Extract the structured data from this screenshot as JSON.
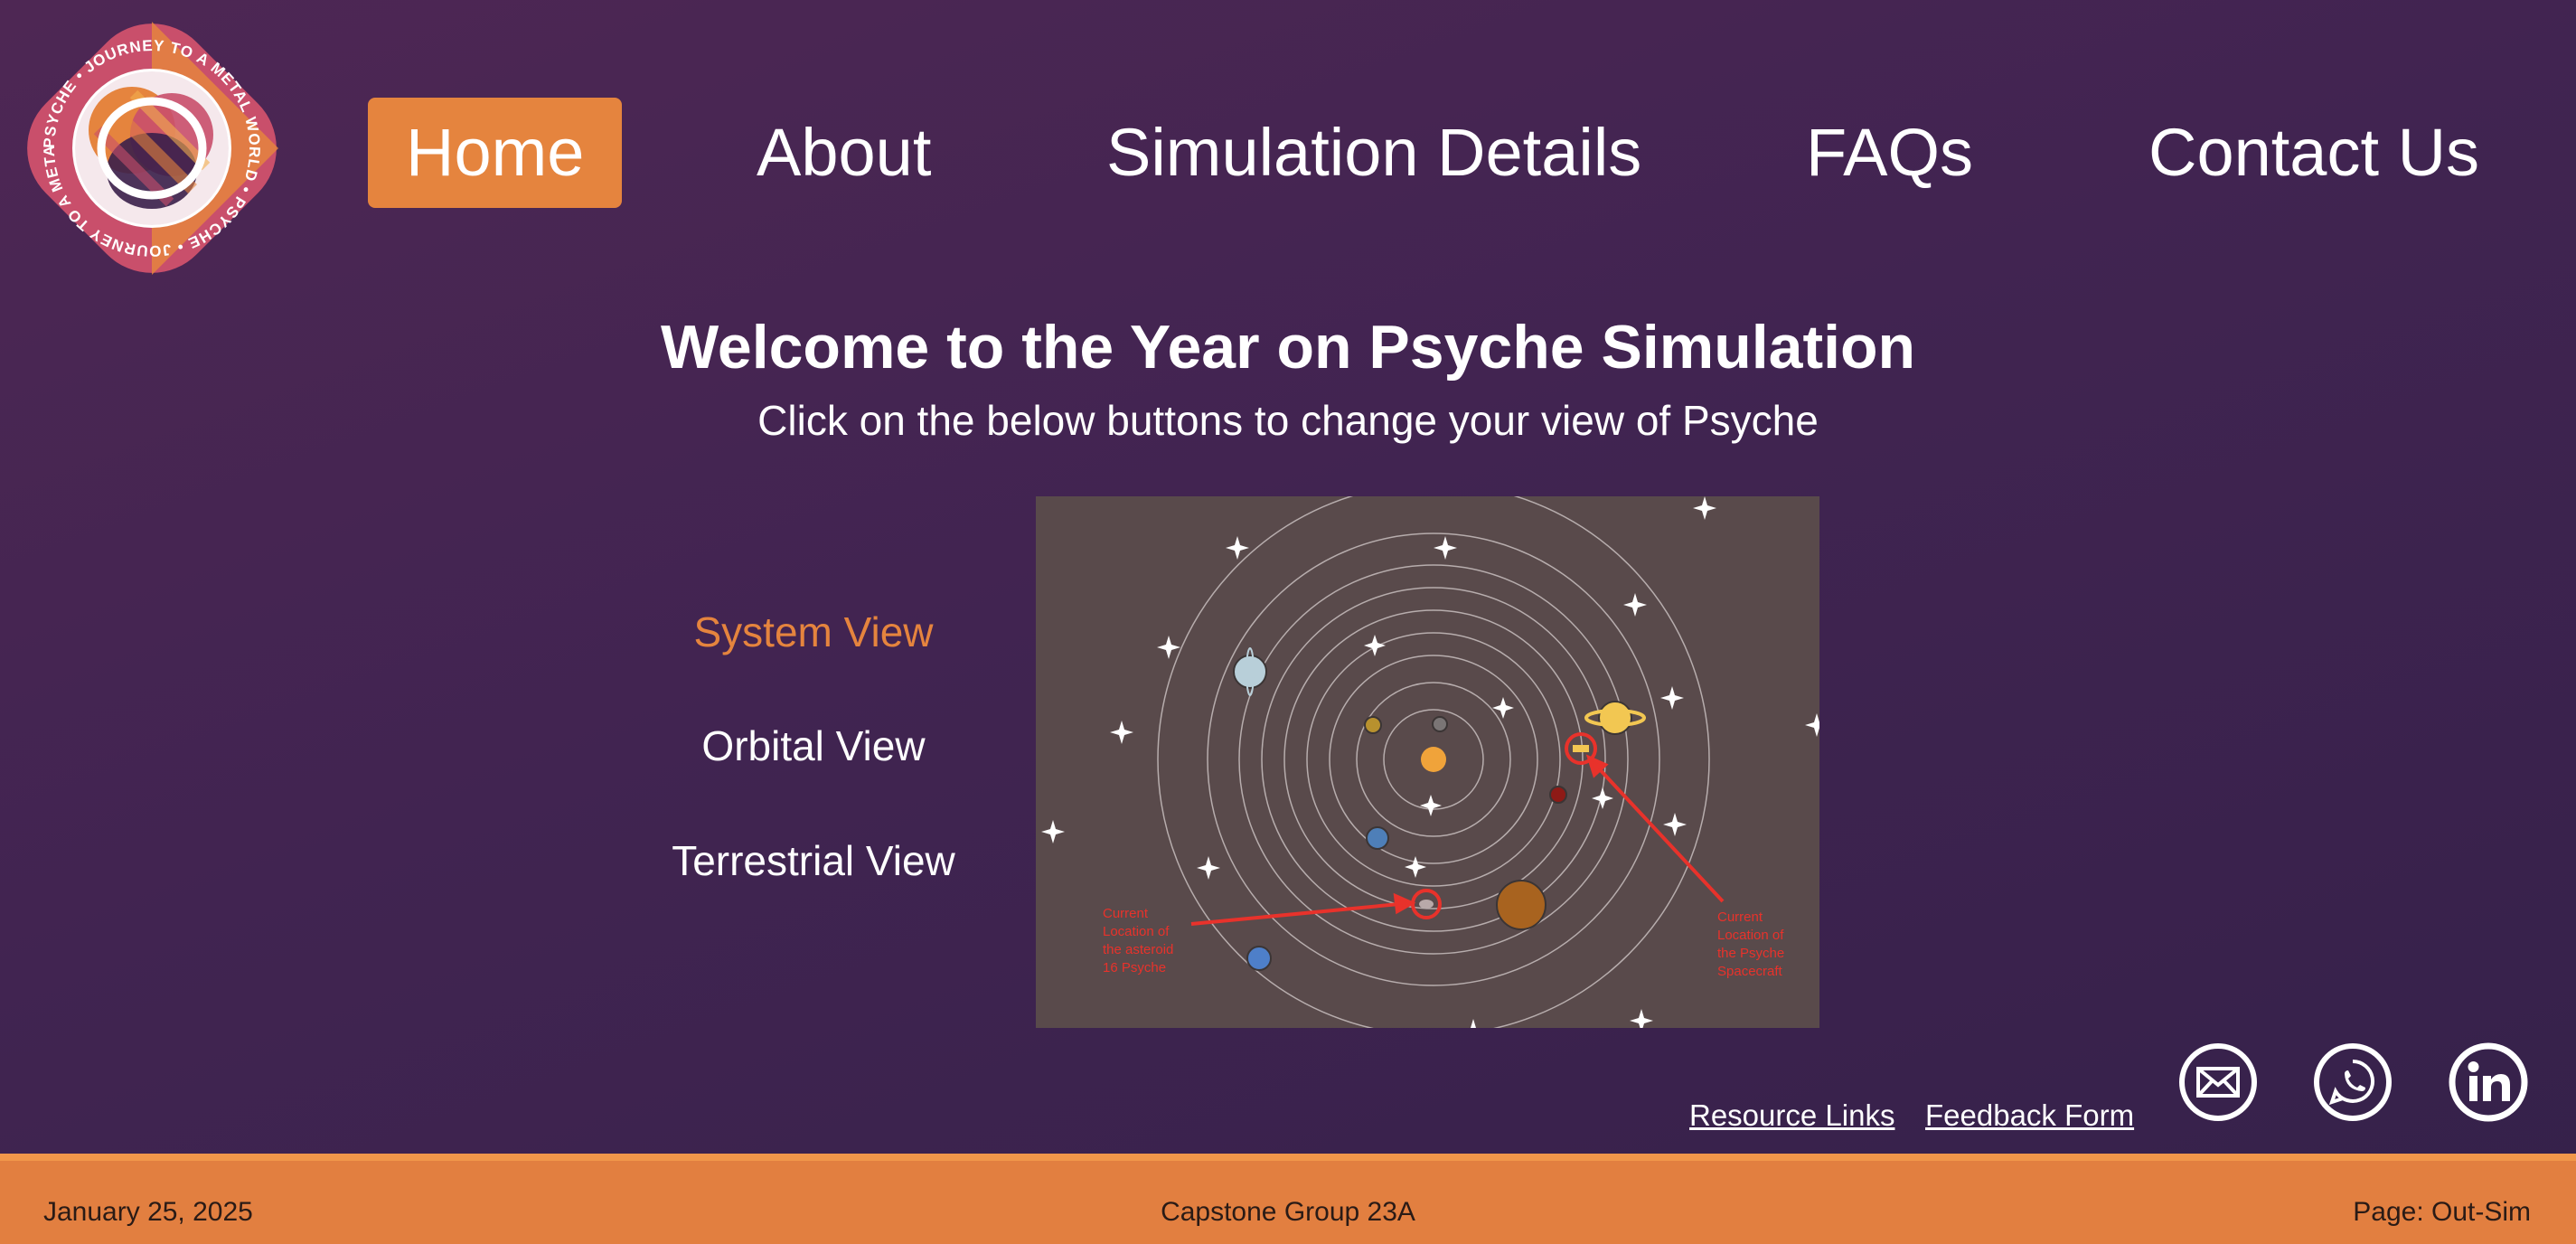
{
  "logo": {
    "text": "PSYCHE • JOURNEY TO A METAL WORLD • PSYCHE • JOURNEY TO A METAL WORLD •",
    "colors": {
      "orange": "#e5843e",
      "pink": "#c94f6b",
      "purple": "#3a1f4a"
    }
  },
  "nav": {
    "items": [
      {
        "label": "Home",
        "active": true
      },
      {
        "label": "About"
      },
      {
        "label": "Simulation Details"
      },
      {
        "label": "FAQs"
      },
      {
        "label": "Contact Us"
      }
    ]
  },
  "main": {
    "title": "Welcome to the Year on Psyche Simulation",
    "subtitle": "Click on the below buttons to change your view of Psyche"
  },
  "views": [
    {
      "label": "System View",
      "active": true
    },
    {
      "label": "Orbital View"
    },
    {
      "label": "Terrestrial View"
    }
  ],
  "simulation": {
    "asteroid_label": [
      "Current",
      "Location of",
      "the asteroid",
      "16 Psyche"
    ],
    "spacecraft_label": [
      "Current",
      "Location of",
      "the Psyche",
      "Spacecraft"
    ],
    "annotation_color": "#e8322b"
  },
  "footer_links": {
    "resources": "Resource Links",
    "feedback": "Feedback Form"
  },
  "social_icons": [
    "mail-icon",
    "whatsapp-icon",
    "linkedin-icon"
  ],
  "footer": {
    "date": "January 25, 2025",
    "group": "Capstone Group 23A",
    "page": "Page: Out-Sim"
  },
  "colors": {
    "accent": "#e5843e",
    "background": "#412451",
    "footer": "#e27f40"
  }
}
